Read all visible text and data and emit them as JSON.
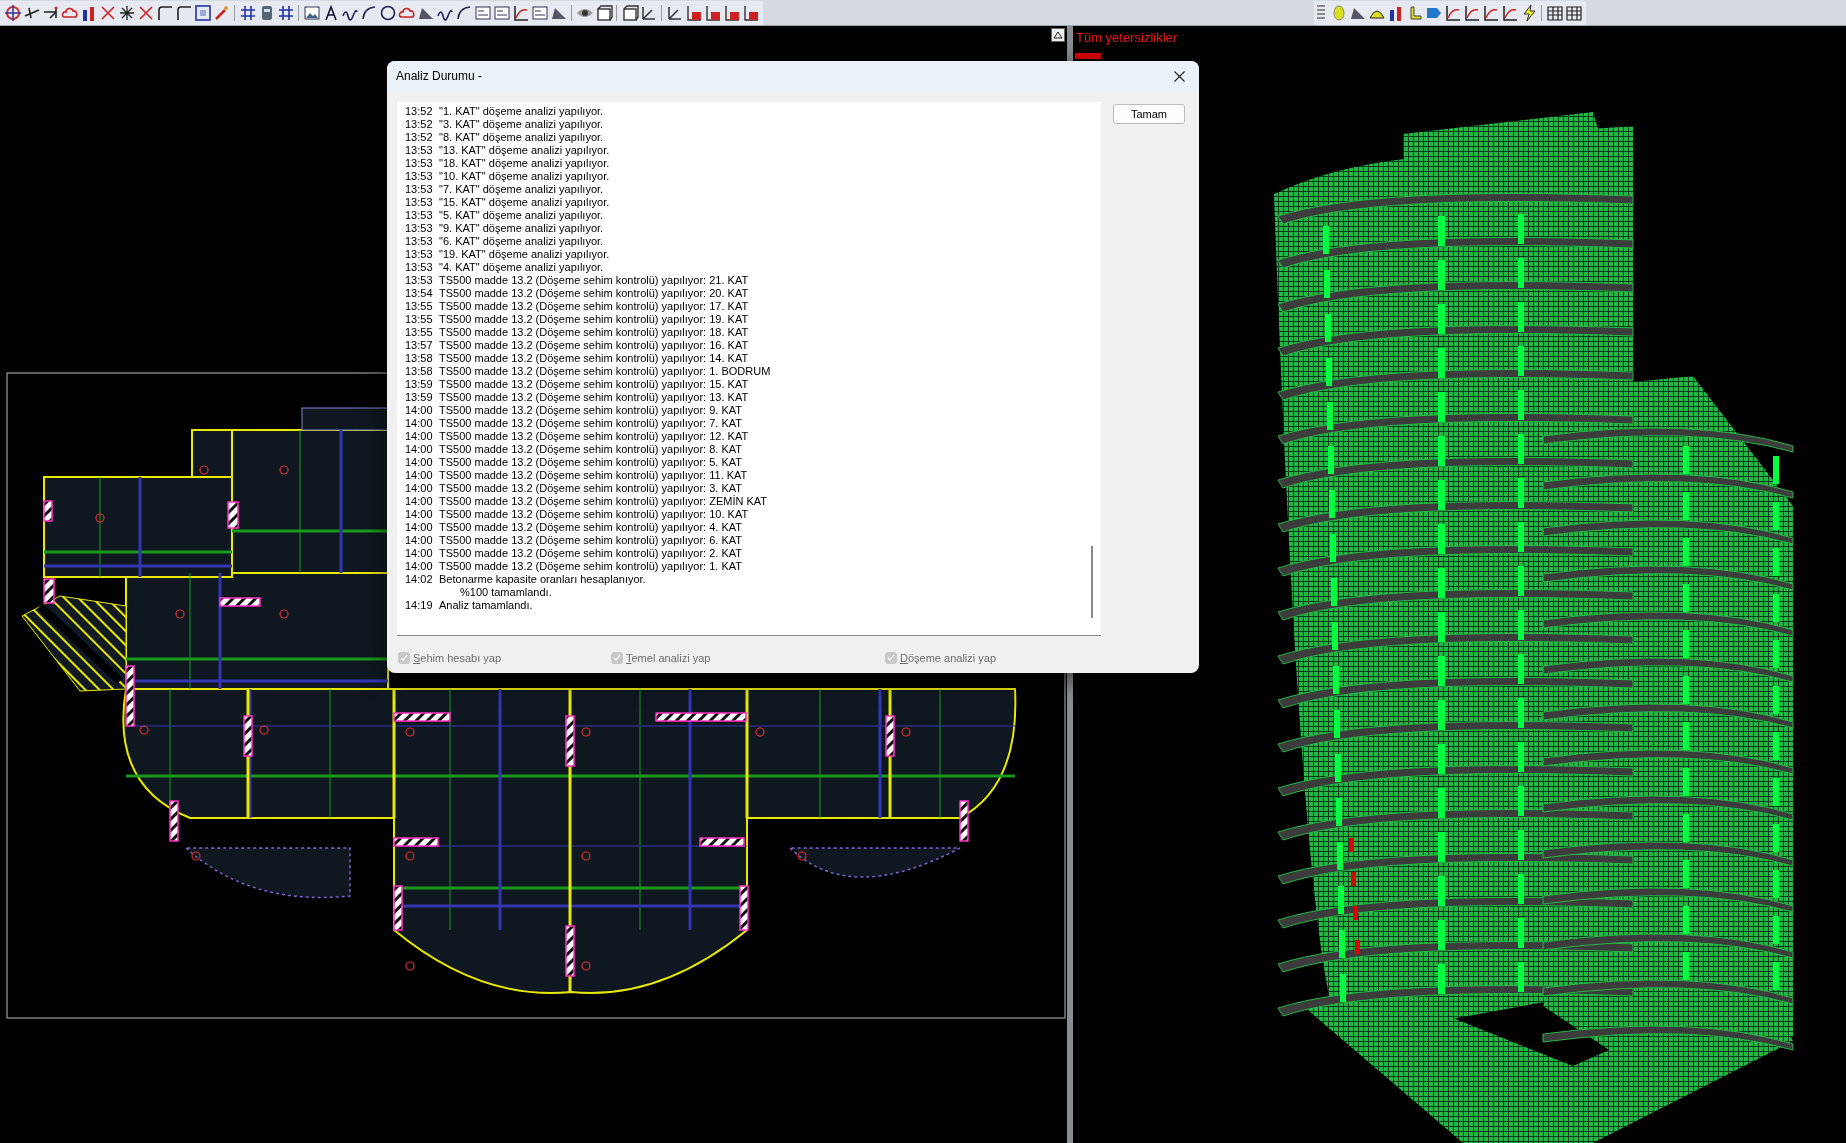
{
  "viewport_3d": {
    "label": "Tüm yetersizlikler"
  },
  "dialog": {
    "title": "Analiz Durumu -",
    "log": [
      {
        "time": "13:52",
        "text": "\"1. KAT\" döşeme analizi yapılıyor."
      },
      {
        "time": "13:52",
        "text": "\"3. KAT\" döşeme analizi yapılıyor."
      },
      {
        "time": "13:52",
        "text": "\"8. KAT\" döşeme analizi yapılıyor."
      },
      {
        "time": "13:53",
        "text": "\"13. KAT\" döşeme analizi yapılıyor."
      },
      {
        "time": "13:53",
        "text": "\"18. KAT\" döşeme analizi yapılıyor."
      },
      {
        "time": "13:53",
        "text": "\"10. KAT\" döşeme analizi yapılıyor."
      },
      {
        "time": "13:53",
        "text": "\"7. KAT\" döşeme analizi yapılıyor."
      },
      {
        "time": "13:53",
        "text": "\"15. KAT\" döşeme analizi yapılıyor."
      },
      {
        "time": "13:53",
        "text": "\"5. KAT\" döşeme analizi yapılıyor."
      },
      {
        "time": "13:53",
        "text": "\"9. KAT\" döşeme analizi yapılıyor."
      },
      {
        "time": "13:53",
        "text": "\"6. KAT\" döşeme analizi yapılıyor."
      },
      {
        "time": "13:53",
        "text": "\"19. KAT\" döşeme analizi yapılıyor."
      },
      {
        "time": "13:53",
        "text": "\"4. KAT\" döşeme analizi yapılıyor."
      },
      {
        "time": "13:53",
        "text": "TS500 madde 13.2 (Döşeme sehim kontrolü) yapılıyor: 21. KAT"
      },
      {
        "time": "13:54",
        "text": "TS500 madde 13.2 (Döşeme sehim kontrolü) yapılıyor: 20. KAT"
      },
      {
        "time": "13:55",
        "text": "TS500 madde 13.2 (Döşeme sehim kontrolü) yapılıyor: 17. KAT"
      },
      {
        "time": "13:55",
        "text": "TS500 madde 13.2 (Döşeme sehim kontrolü) yapılıyor: 19. KAT"
      },
      {
        "time": "13:55",
        "text": "TS500 madde 13.2 (Döşeme sehim kontrolü) yapılıyor: 18. KAT"
      },
      {
        "time": "13:57",
        "text": "TS500 madde 13.2 (Döşeme sehim kontrolü) yapılıyor: 16. KAT"
      },
      {
        "time": "13:58",
        "text": "TS500 madde 13.2 (Döşeme sehim kontrolü) yapılıyor: 14. KAT"
      },
      {
        "time": "13:58",
        "text": "TS500 madde 13.2 (Döşeme sehim kontrolü) yapılıyor: 1. BODRUM"
      },
      {
        "time": "13:59",
        "text": "TS500 madde 13.2 (Döşeme sehim kontrolü) yapılıyor: 15. KAT"
      },
      {
        "time": "13:59",
        "text": "TS500 madde 13.2 (Döşeme sehim kontrolü) yapılıyor: 13. KAT"
      },
      {
        "time": "14:00",
        "text": "TS500 madde 13.2 (Döşeme sehim kontrolü) yapılıyor: 9. KAT"
      },
      {
        "time": "14:00",
        "text": "TS500 madde 13.2 (Döşeme sehim kontrolü) yapılıyor: 7. KAT"
      },
      {
        "time": "14:00",
        "text": "TS500 madde 13.2 (Döşeme sehim kontrolü) yapılıyor: 12. KAT"
      },
      {
        "time": "14:00",
        "text": "TS500 madde 13.2 (Döşeme sehim kontrolü) yapılıyor: 8. KAT"
      },
      {
        "time": "14:00",
        "text": "TS500 madde 13.2 (Döşeme sehim kontrolü) yapılıyor: 5. KAT"
      },
      {
        "time": "14:00",
        "text": "TS500 madde 13.2 (Döşeme sehim kontrolü) yapılıyor: 11. KAT"
      },
      {
        "time": "14:00",
        "text": "TS500 madde 13.2 (Döşeme sehim kontrolü) yapılıyor: 3. KAT"
      },
      {
        "time": "14:00",
        "text": "TS500 madde 13.2 (Döşeme sehim kontrolü) yapılıyor: ZEMİN KAT"
      },
      {
        "time": "14:00",
        "text": "TS500 madde 13.2 (Döşeme sehim kontrolü) yapılıyor: 10. KAT"
      },
      {
        "time": "14:00",
        "text": "TS500 madde 13.2 (Döşeme sehim kontrolü) yapılıyor: 4. KAT"
      },
      {
        "time": "14:00",
        "text": "TS500 madde 13.2 (Döşeme sehim kontrolü) yapılıyor: 6. KAT"
      },
      {
        "time": "14:00",
        "text": "TS500 madde 13.2 (Döşeme sehim kontrolü) yapılıyor: 2. KAT"
      },
      {
        "time": "14:00",
        "text": "TS500 madde 13.2 (Döşeme sehim kontrolü) yapılıyor: 1. KAT"
      },
      {
        "time": "14:02",
        "text": "Betonarme kapasite oranları hesaplanıyor."
      },
      {
        "text": "%100 tamamlandı."
      },
      {
        "time": "14:19",
        "text": "Analiz tamamlandı."
      }
    ],
    "buttons": [
      "Tamam"
    ],
    "options": [
      {
        "label": "Sehim hesabı yap",
        "checked": true,
        "disabled": true
      },
      {
        "label": "Temel analizi yap",
        "checked": true,
        "disabled": true
      },
      {
        "label": "Döşeme analizi yap",
        "checked": true,
        "disabled": true
      }
    ]
  }
}
